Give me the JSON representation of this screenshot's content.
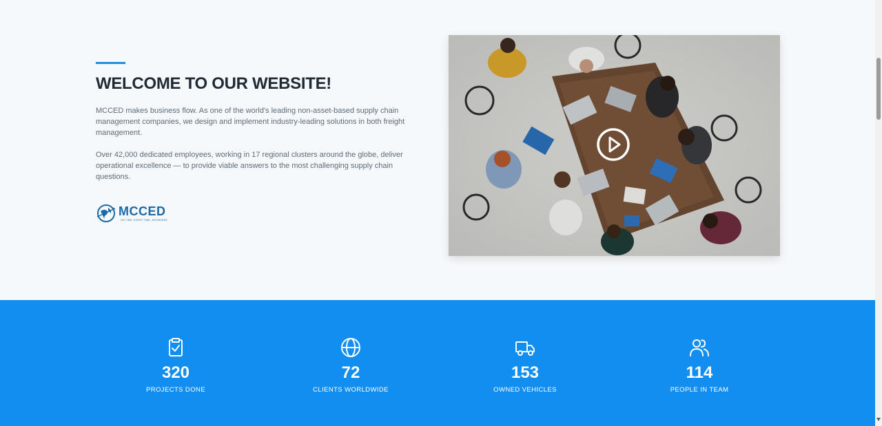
{
  "about": {
    "title": "WELCOME TO OUR WEBSITE!",
    "paragraph_1": "MCCED makes business flow. As one of the world's leading non-asset-based supply chain management companies, we design and implement industry-leading solutions in both freight management.",
    "paragraph_2": "Over 42,000 dedicated employees, working in 17 regional clusters around the globe, deliver operational excellence — to provide viable answers to the most challenging supply chain questions.",
    "logo_text": "MCCED",
    "logo_tagline": "ON TIME, EVERY TIME, ANYWHERE",
    "accent_color": "#1b8fe8"
  },
  "video": {
    "play_icon": "play-circle-icon"
  },
  "stats": {
    "background": "#118ef0",
    "items": [
      {
        "icon": "clipboard-check-icon",
        "value": "320",
        "label": "PROJECTS DONE"
      },
      {
        "icon": "globe-icon",
        "value": "72",
        "label": "CLIENTS WORLDWIDE"
      },
      {
        "icon": "truck-icon",
        "value": "153",
        "label": "OWNED VEHICLES"
      },
      {
        "icon": "users-icon",
        "value": "114",
        "label": "PEOPLE IN TEAM"
      }
    ]
  }
}
